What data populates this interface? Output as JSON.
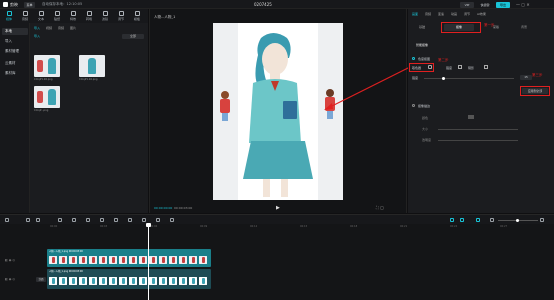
{
  "app": {
    "name": "剪映",
    "menu_label": "菜单",
    "autosave": "自动保存本地：12:10:05",
    "window_title": "0207425"
  },
  "titlebar_right": {
    "vip": "VIP",
    "shortcut": "快捷键",
    "export": "导出"
  },
  "toolbar": {
    "items": [
      "媒体",
      "音频",
      "文本",
      "贴纸",
      "特效",
      "转场",
      "滤镜",
      "调节",
      "模板"
    ]
  },
  "left_nav": {
    "items": [
      "本地",
      "导入",
      "素材管理",
      "云素材",
      "素材库"
    ]
  },
  "media": {
    "tabs": [
      "导入",
      "视频",
      "音频",
      "图片"
    ],
    "import_label": "导入",
    "sort_label": "全部",
    "thumb_labels": [
      "Cmqif1.16.png",
      "Cmqif1.16.png",
      "Cmqif...png"
    ]
  },
  "player": {
    "title": "播放器",
    "clip_name": "人物...人物_1",
    "timecode": "00:00:00:00",
    "duration": "00:00:03:00"
  },
  "props": {
    "tabs": [
      "画面",
      "音频",
      "变速",
      "动画",
      "调节",
      "AI效果"
    ],
    "subtabs": [
      "基础",
      "抠像",
      "蒙版",
      "背景"
    ],
    "annotation_1": "第一步",
    "annotation_2": "第二步",
    "annotation_3": "第三步",
    "section_title": "智能抠像",
    "option_label": "色度抠图",
    "color_picker_label": "取色器",
    "strength_label": "强度",
    "shadow_label": "阴影",
    "strength_value": "15",
    "apply_button": "应用到全部",
    "edge_section": "抠像描边",
    "edge_rows": [
      "颜色",
      "大小",
      "透明度"
    ]
  },
  "timeline": {
    "ticks": [
      "00:00",
      "00:03",
      "00:06",
      "00:09",
      "00:12",
      "00:15",
      "00:18",
      "00:21",
      "00:24",
      "00:27"
    ],
    "clip1_label": "人物...人物_1.png  00:00:03:00",
    "clip2_label": "人物...人物_1.png  00:00:03:00",
    "track_head": "封面"
  },
  "colors": {
    "accent": "#19c3d6",
    "annotation": "#e02020"
  }
}
